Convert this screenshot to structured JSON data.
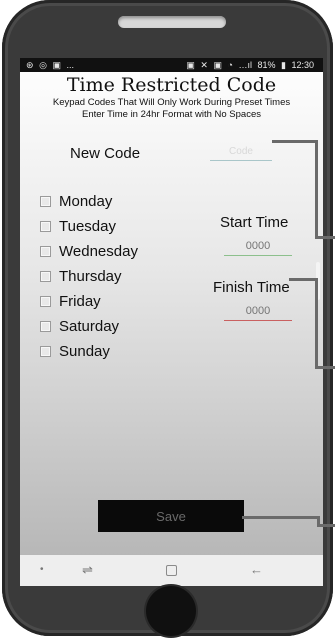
{
  "status_bar": {
    "left_icons": [
      "⊛",
      "◎",
      "▣",
      "..."
    ],
    "right_icons": [
      "▣",
      "✕",
      "▣",
      "◔"
    ],
    "signal": "…ıl",
    "battery_percent": "81%",
    "battery_icon": "▮",
    "time": "12:30"
  },
  "header": {
    "title": "Time Restricted Code",
    "subtitle_line1": "Keypad Codes That Will Only Work During Preset Times",
    "subtitle_line2": "Enter Time in 24hr Format with No Spaces"
  },
  "form": {
    "new_code_label": "New Code",
    "code_placeholder": "Code",
    "days": [
      "Monday",
      "Tuesday",
      "Wednesday",
      "Thursday",
      "Friday",
      "Saturday",
      "Sunday"
    ],
    "start_time_label": "Start Time",
    "start_time_placeholder": "0000",
    "finish_time_label": "Finish Time",
    "finish_time_placeholder": "0000",
    "save_label": "Save"
  },
  "nav_bar": {
    "dot": "•",
    "recent_icon": "⇌",
    "back_icon": "←"
  },
  "colors": {
    "start_underline": "#8cc08c",
    "finish_underline": "#c96060",
    "code_underline": "#a9c6c9"
  }
}
